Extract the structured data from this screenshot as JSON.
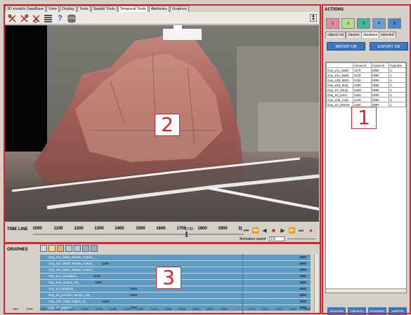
{
  "tabs": [
    "3D models DataBase",
    "View",
    "Display",
    "Tools",
    "Spatial Tools",
    "Temporal Tools",
    "Attributes",
    "Graphes"
  ],
  "active_tab": "Temporal Tools",
  "toolbar_icons": [
    "cut-tool-icon",
    "cut-tool-icon",
    "cut-tool-icon",
    "list-icon",
    "help-icon",
    "database-icon"
  ],
  "timeline": {
    "label": "TIME LINE",
    "ticks": [
      "1000",
      "1100",
      "1200",
      "1300",
      "1400",
      "1500",
      "1600",
      "1700",
      "1800",
      "1900",
      "2("
    ],
    "current": "1730",
    "animation_label": "Animation speed",
    "animation_value": "2.0"
  },
  "graphs": {
    "label": "GRAPHES",
    "rows": [
      {
        "name": "Guy_e1c_batt1_donjon_corps1_",
        "start": "",
        "end": "1990",
        "fill": 1.0
      },
      {
        "name": "Guy_e1c_batt3_donjon_corps3_",
        "start": "1240",
        "end": "1990",
        "fill": 1.0
      },
      {
        "name": "Guy_e1c_batt1_donjon_corps2_",
        "start": "",
        "end": "1990",
        "fill": 1.0
      },
      {
        "name": "Guy_e1c_fondation_",
        "start": "1170",
        "end": "1990",
        "fill": 1.0
      },
      {
        "name": "Guy_e2a_donjon_S2_",
        "start": "1200",
        "end": "1990",
        "fill": 1.0
      },
      {
        "name": "Guy_e2_donjonN_",
        "start": "1340",
        "end": "1990",
        "fill": 1.0
      },
      {
        "name": "Guy_e2_jonction_donjon_NS_",
        "start": "1340",
        "end": "1990",
        "fill": 1.0
      },
      {
        "name": "Guy_e2b_corps_logis1_O_",
        "start": "1240",
        "end": "1990",
        "fill": 1.0
      },
      {
        "name": "Guy_e2_pNorw2_",
        "start": "1340",
        "end": "1990",
        "fill": 1.0
      }
    ],
    "axis": [
      "960",
      "1008",
      "1056",
      "1104",
      "1152",
      "1200",
      "1248",
      "1296",
      "1344",
      "1392",
      "1440",
      "1488",
      "1536",
      "1584",
      "1632",
      "1680",
      "1728",
      "1776",
      "1824",
      "1872",
      "1920",
      "1968"
    ],
    "axis_marker": "1728"
  },
  "actions": {
    "label": "ACTIONS",
    "buttons": [
      {
        "label": "1",
        "color": "#e58b97"
      },
      {
        "label": "2",
        "color": "#b9dc8a"
      },
      {
        "label": "3",
        "color": "#3fb8a0"
      },
      {
        "label": "4",
        "color": "#6b9fd6"
      },
      {
        "label": "5",
        "color": "#4c86d0"
      }
    ]
  },
  "right_tabs": [
    "objects list",
    "classes",
    "database",
    "selected"
  ],
  "right_active_tab": "database",
  "import_label": "IMPORT DB",
  "export_label": "EXPORT DB",
  "db_table": {
    "headers": [
      "",
      "Annee D",
      "Annee D",
      "Hypothe"
    ],
    "rows": [
      [
        "Guy_e1c_batt1",
        "1170",
        "1990",
        "1"
      ],
      [
        "Guy_e1c_batt3",
        "1170",
        "1990",
        "1"
      ],
      [
        "Guy_e2b_batt3",
        "1240",
        "1990",
        "1"
      ],
      [
        "Guy_e2a_donj",
        "1200",
        "1990",
        "1"
      ],
      [
        "Guy_e2_donjo",
        "1340",
        "1990",
        "1"
      ],
      [
        "Guy_e2_jonct",
        "1340",
        "1990",
        "1"
      ],
      [
        "Guy_e2b_corp",
        "1240",
        "1990",
        "1"
      ],
      [
        "Guy_e2_pNorw",
        "1340",
        "1990",
        "1"
      ]
    ]
  },
  "bottom_buttons": [
    "showAllW",
    "hideTemp",
    "showSelec",
    "addToTo"
  ],
  "annotations": [
    "1",
    "2",
    "3"
  ]
}
